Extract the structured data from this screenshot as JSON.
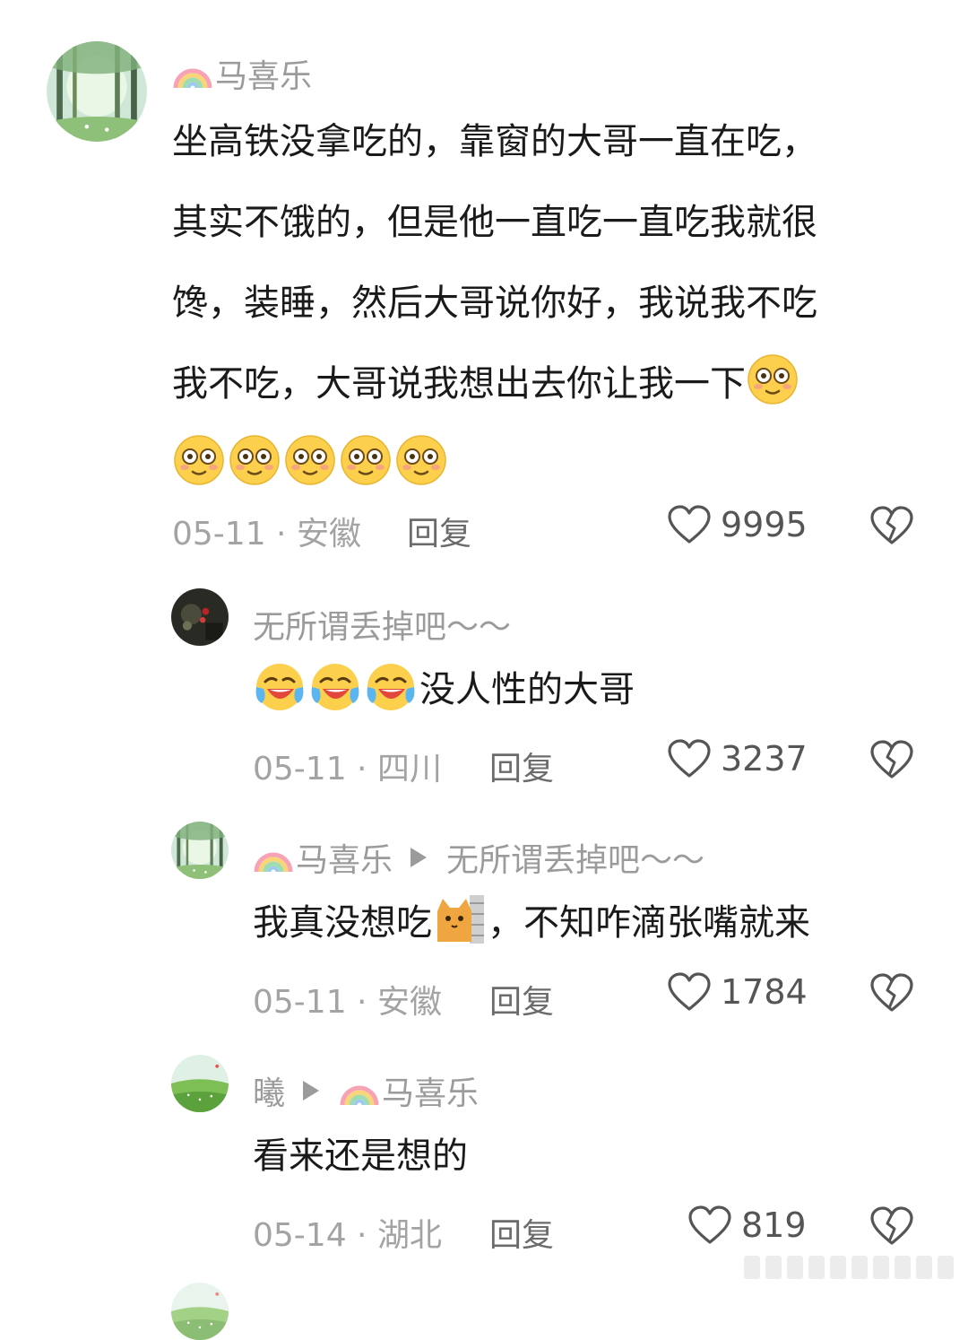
{
  "comments": [
    {
      "user": "马喜乐",
      "text_line1": "坐高铁没拿吃的，靠窗的大哥一直在吃，",
      "text_line2": "其实不饿的，但是他一直吃一直吃我就很",
      "text_line3": "馋，装睡，然后大哥说你好，我说我不吃",
      "text_line4": "我不吃，大哥说我想出去你让我一下",
      "date_location": "05-11 · 安徽",
      "reply_label": "回复",
      "likes": "9995"
    },
    {
      "user": "无所谓丢掉吧～～",
      "text": "没人性的大哥",
      "date_location": "05-11 · 四川",
      "reply_label": "回复",
      "likes": "3237"
    },
    {
      "user": "马喜乐",
      "reply_to": "无所谓丢掉吧～～",
      "text_part1": "我真没想吃",
      "text_part2": "，不知咋滴张嘴就来",
      "date_location": "05-11 · 安徽",
      "reply_label": "回复",
      "likes": "1784"
    },
    {
      "user": "曦",
      "reply_to": "马喜乐",
      "text": "看来还是想的",
      "date_location": "05-14 · 湖北",
      "reply_label": "回复",
      "likes": "819"
    }
  ],
  "icons": {
    "like": "heart-outline-icon",
    "dislike": "broken-heart-icon",
    "rainbow": "rainbow-emoji",
    "flushed": "flushed-face-emoji",
    "laugh_cry": "rolling-laughing-emoji",
    "cat_wall": "cat-peeking-wall-emoji"
  }
}
